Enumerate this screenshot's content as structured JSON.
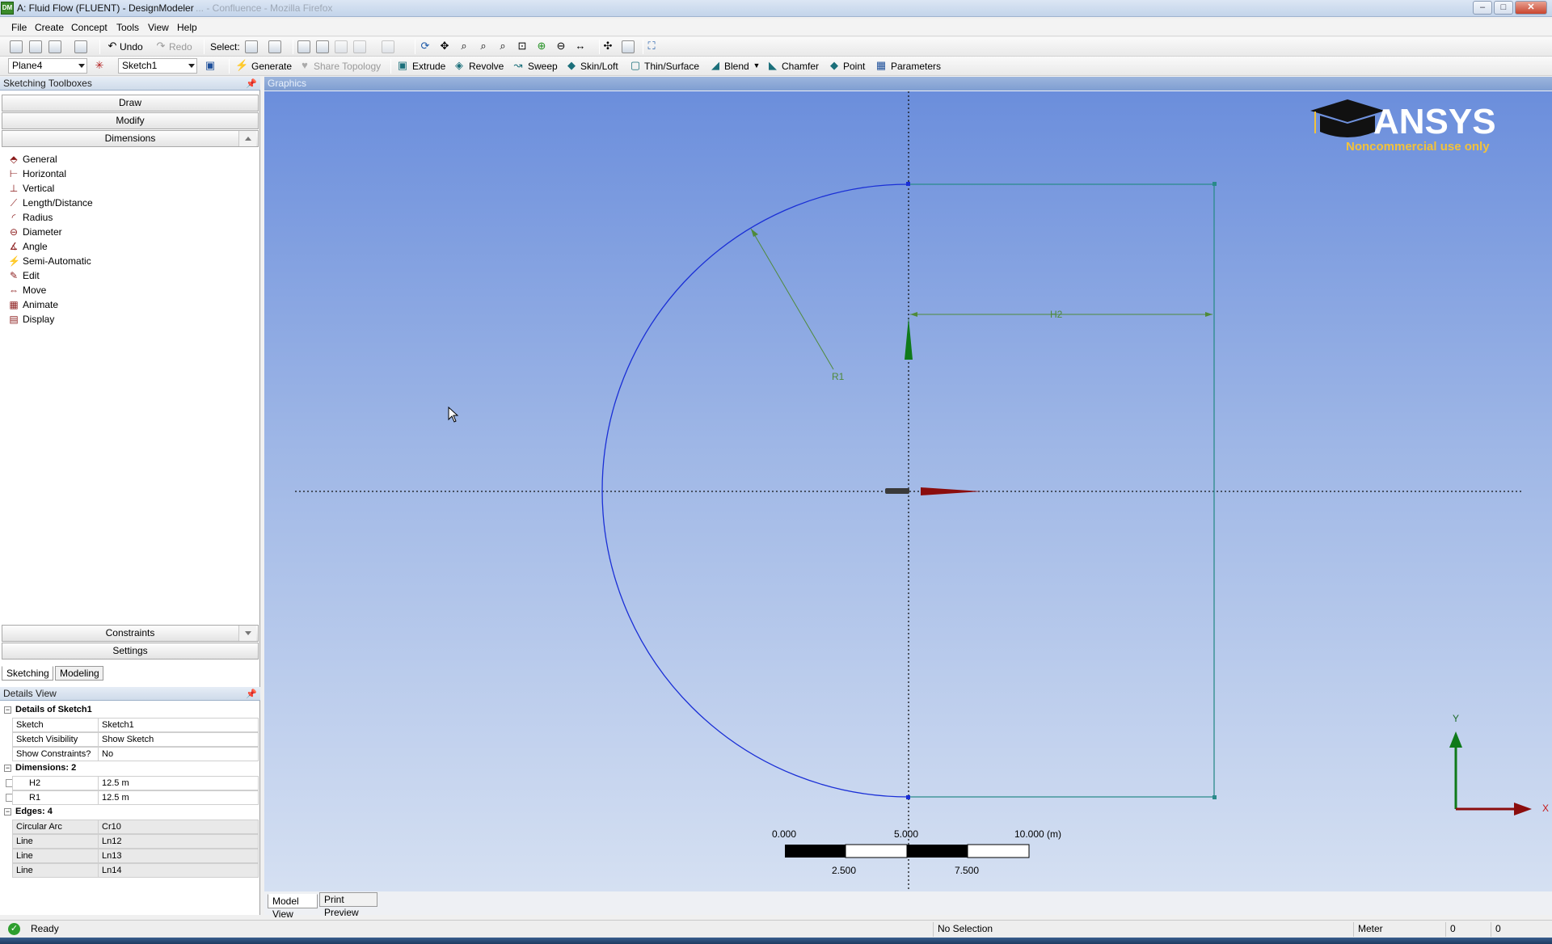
{
  "window": {
    "title": "A: Fluid Flow (FLUENT) - DesignModeler",
    "title_ghost": "... - Confluence - Mozilla Firefox",
    "app_icon": "DM"
  },
  "menu": [
    "File",
    "Create",
    "Concept",
    "Tools",
    "View",
    "Help"
  ],
  "toolbar1": {
    "undo_label": "Undo",
    "redo_label": "Redo",
    "select_label": "Select:"
  },
  "toolbar2": {
    "plane_value": "Plane4",
    "sketch_value": "Sketch1",
    "generate_label": "Generate",
    "share_topology_label": "Share Topology",
    "extrude_label": "Extrude",
    "revolve_label": "Revolve",
    "sweep_label": "Sweep",
    "skin_loft_label": "Skin/Loft",
    "thin_surface_label": "Thin/Surface",
    "blend_label": "Blend",
    "chamfer_label": "Chamfer",
    "point_label": "Point",
    "parameters_label": "Parameters"
  },
  "sketching_toolboxes": {
    "header": "Sketching Toolboxes",
    "sections": {
      "draw": "Draw",
      "modify": "Modify",
      "dimensions": "Dimensions",
      "constraints": "Constraints",
      "settings": "Settings"
    },
    "dimension_tools": [
      {
        "label": "General",
        "icon": "general-dimension-icon",
        "glyph": "⬘"
      },
      {
        "label": "Horizontal",
        "icon": "horizontal-dimension-icon",
        "glyph": "⊢"
      },
      {
        "label": "Vertical",
        "icon": "vertical-dimension-icon",
        "glyph": "⊥"
      },
      {
        "label": "Length/Distance",
        "icon": "length-distance-icon",
        "glyph": "⟋"
      },
      {
        "label": "Radius",
        "icon": "radius-icon",
        "glyph": "◜"
      },
      {
        "label": "Diameter",
        "icon": "diameter-icon",
        "glyph": "⊖"
      },
      {
        "label": "Angle",
        "icon": "angle-icon",
        "glyph": "∡"
      },
      {
        "label": "Semi-Automatic",
        "icon": "semi-automatic-icon",
        "glyph": "⚡"
      },
      {
        "label": "Edit",
        "icon": "edit-icon",
        "glyph": "✎"
      },
      {
        "label": "Move",
        "icon": "move-icon",
        "glyph": "⇔"
      },
      {
        "label": "Animate",
        "icon": "animate-icon",
        "glyph": "▦"
      },
      {
        "label": "Display",
        "icon": "display-icon",
        "glyph": "▤"
      }
    ]
  },
  "tree_tabs": [
    "Sketching",
    "Modeling"
  ],
  "details": {
    "header": "Details View",
    "group1": "Details of Sketch1",
    "rows1": [
      {
        "name": "Sketch",
        "value": "Sketch1"
      },
      {
        "name": "Sketch Visibility",
        "value": "Show Sketch"
      },
      {
        "name": "Show Constraints?",
        "value": "No"
      }
    ],
    "group2": "Dimensions: 2",
    "rows2": [
      {
        "name": "H2",
        "value": "12.5 m"
      },
      {
        "name": "R1",
        "value": "12.5 m"
      }
    ],
    "group3": "Edges: 4",
    "rows3": [
      {
        "name": "Circular Arc",
        "value": "Cr10"
      },
      {
        "name": "Line",
        "value": "Ln12"
      },
      {
        "name": "Line",
        "value": "Ln13"
      },
      {
        "name": "Line",
        "value": "Ln14"
      }
    ]
  },
  "graphics": {
    "header": "Graphics",
    "logo_text": "ANSYS",
    "logo_subtext": "Noncommercial use only",
    "dim_h_label": "H2",
    "dim_r_label": "R1",
    "scale_labels_top": [
      "0.000",
      "5.000",
      "10.000 (m)"
    ],
    "scale_labels_bottom": [
      "2.500",
      "7.500"
    ],
    "triad_y": "Y",
    "triad_x": "X"
  },
  "view_tabs": [
    "Model View",
    "Print Preview"
  ],
  "status": {
    "ready": "Ready",
    "selection": "No Selection",
    "units": "Meter",
    "val1": "0",
    "val2": "0"
  },
  "colors": {
    "sketch_arc": "#1a2fd6",
    "sketch_line": "#2a8a8a",
    "dimension": "#4f8a3a",
    "axis_x_arrow": "#8b0d0d",
    "axis_y_arrow": "#0f7a1a",
    "ansys_gold": "#f2c23a"
  }
}
